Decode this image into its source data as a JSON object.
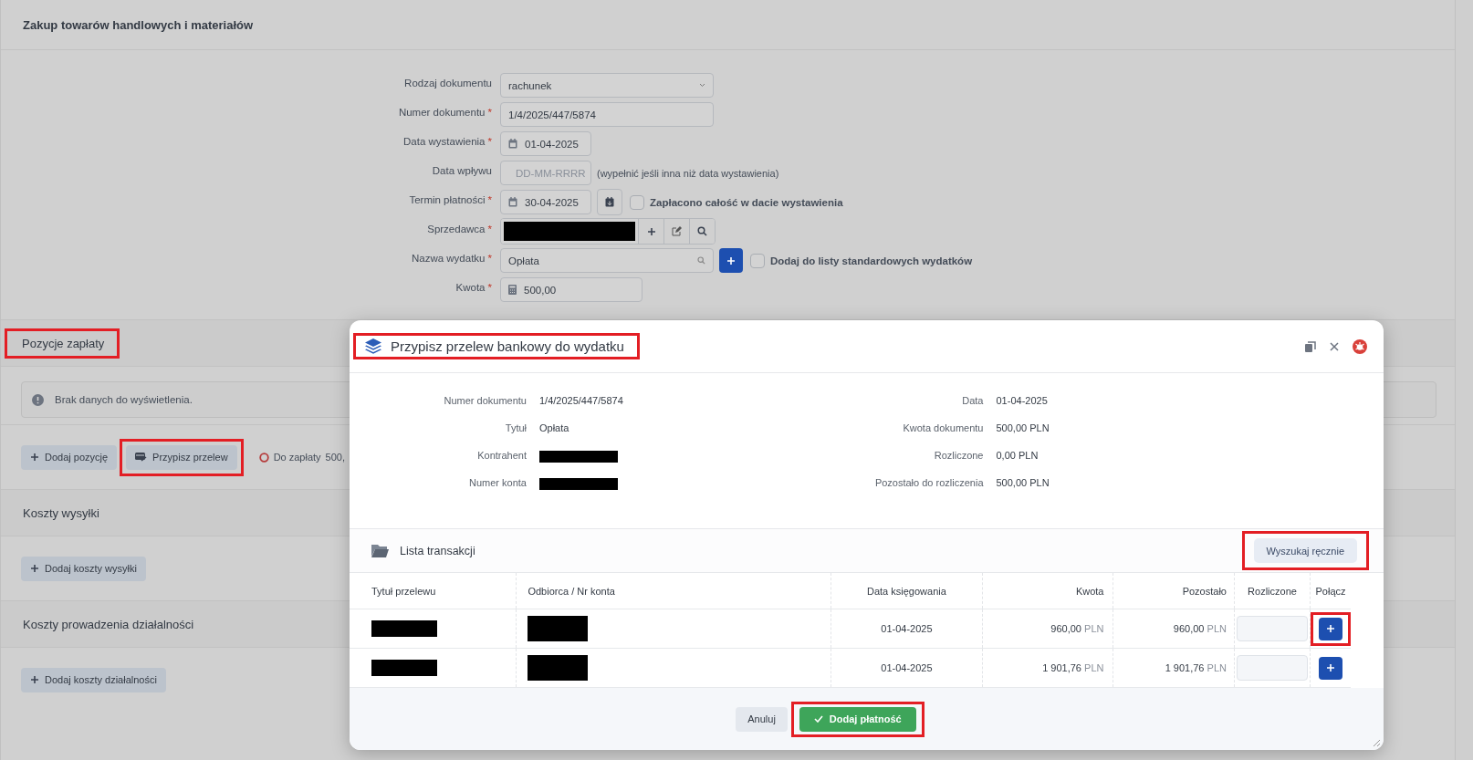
{
  "page_title": "Zakup towarów handlowych i materiałów",
  "form": [
    {
      "kind": "select",
      "label": "Rodzaj dokumentu",
      "value": "rachunek"
    },
    {
      "kind": "text",
      "label": "Numer dokumentu",
      "required_mark": "*",
      "value": "1/4/2025/447/5874"
    },
    {
      "kind": "date",
      "label": "Data wystawienia",
      "required_mark": "*",
      "value": "01-04-2025"
    },
    {
      "kind": "date",
      "label": "Data wpływu",
      "placeholder": "DD-MM-RRRR",
      "hint": "(wypełnić jeśli inna niż data wystawienia)"
    },
    {
      "kind": "date",
      "label": "Termin płatności",
      "required_mark": "*",
      "value": "30-04-2025",
      "calendar_button": true,
      "checkbox": {
        "label": "Zapłacono całość w dacie wystawienia",
        "checked": false
      }
    },
    {
      "kind": "seller",
      "label": "Sprzedawca",
      "required_mark": "*",
      "redacted": true
    },
    {
      "kind": "expense",
      "label": "Nazwa wydatku",
      "required_mark": "*",
      "value": "Opłata",
      "checkbox": {
        "label": "Dodaj do listy standardowych wydatków",
        "checked": false
      }
    },
    {
      "kind": "amount",
      "label": "Kwota",
      "required_mark": "*",
      "value": "500,00"
    }
  ],
  "sections": [
    {
      "title": "Pozycje zapłaty",
      "highlighted": true,
      "empty_message": "Brak danych do wyświetlenia.",
      "buttons": [
        {
          "label": "Dodaj pozycję",
          "kind": "add",
          "highlighted": false
        },
        {
          "label": "Przypisz przelew",
          "kind": "assign",
          "highlighted": true
        }
      ],
      "balance": {
        "label": "Do zapłaty",
        "value": "500,"
      }
    },
    {
      "title": "Koszty wysyłki",
      "highlighted": false,
      "buttons": [
        {
          "label": "Dodaj koszty wysyłki",
          "kind": "add",
          "highlighted": false
        }
      ]
    },
    {
      "title": "Koszty prowadzenia działalności",
      "highlighted": false,
      "buttons": [
        {
          "label": "Dodaj koszty działalności",
          "kind": "add",
          "highlighted": false
        }
      ]
    }
  ],
  "modal": {
    "title": "Przypisz przelew bankowy do wydatku",
    "highlighted": true,
    "details_left": [
      {
        "label": "Numer dokumentu",
        "value": "1/4/2025/447/5874",
        "redacted": false
      },
      {
        "label": "Tytuł",
        "value": "Opłata",
        "redacted": false
      },
      {
        "label": "Kontrahent",
        "redacted": true
      },
      {
        "label": "Numer konta",
        "redacted": true
      }
    ],
    "details_right": [
      {
        "label": "Data",
        "value": "01-04-2025"
      },
      {
        "label": "Kwota dokumentu",
        "value": "500,00 PLN"
      },
      {
        "label": "Rozliczone",
        "value": "0,00 PLN"
      },
      {
        "label": "Pozostało do rozliczenia",
        "value": "500,00 PLN"
      }
    ],
    "list_title": "Lista transakcji",
    "search_button": {
      "label": "Wyszukaj ręcznie",
      "highlighted": true
    },
    "columns": [
      "Tytuł przelewu",
      "Odbiorca / Nr konta",
      "Data księgowania",
      "Kwota",
      "Pozostało",
      "Rozliczone",
      "Połącz"
    ],
    "rows": [
      {
        "title_redacted": true,
        "recipient_redacted": true,
        "date": "01-04-2025",
        "amount": "960,00",
        "amount_currency": "PLN",
        "remaining": "960,00",
        "remaining_currency": "PLN",
        "highlighted": true
      },
      {
        "title_redacted": true,
        "recipient_redacted": true,
        "date": "01-04-2025",
        "amount": "1 901,76",
        "amount_currency": "PLN",
        "remaining": "1 901,76",
        "remaining_currency": "PLN",
        "highlighted": false
      }
    ],
    "cancel_button": "Anuluj",
    "confirm_button": {
      "label": "Dodaj płatność",
      "highlighted": true
    }
  }
}
